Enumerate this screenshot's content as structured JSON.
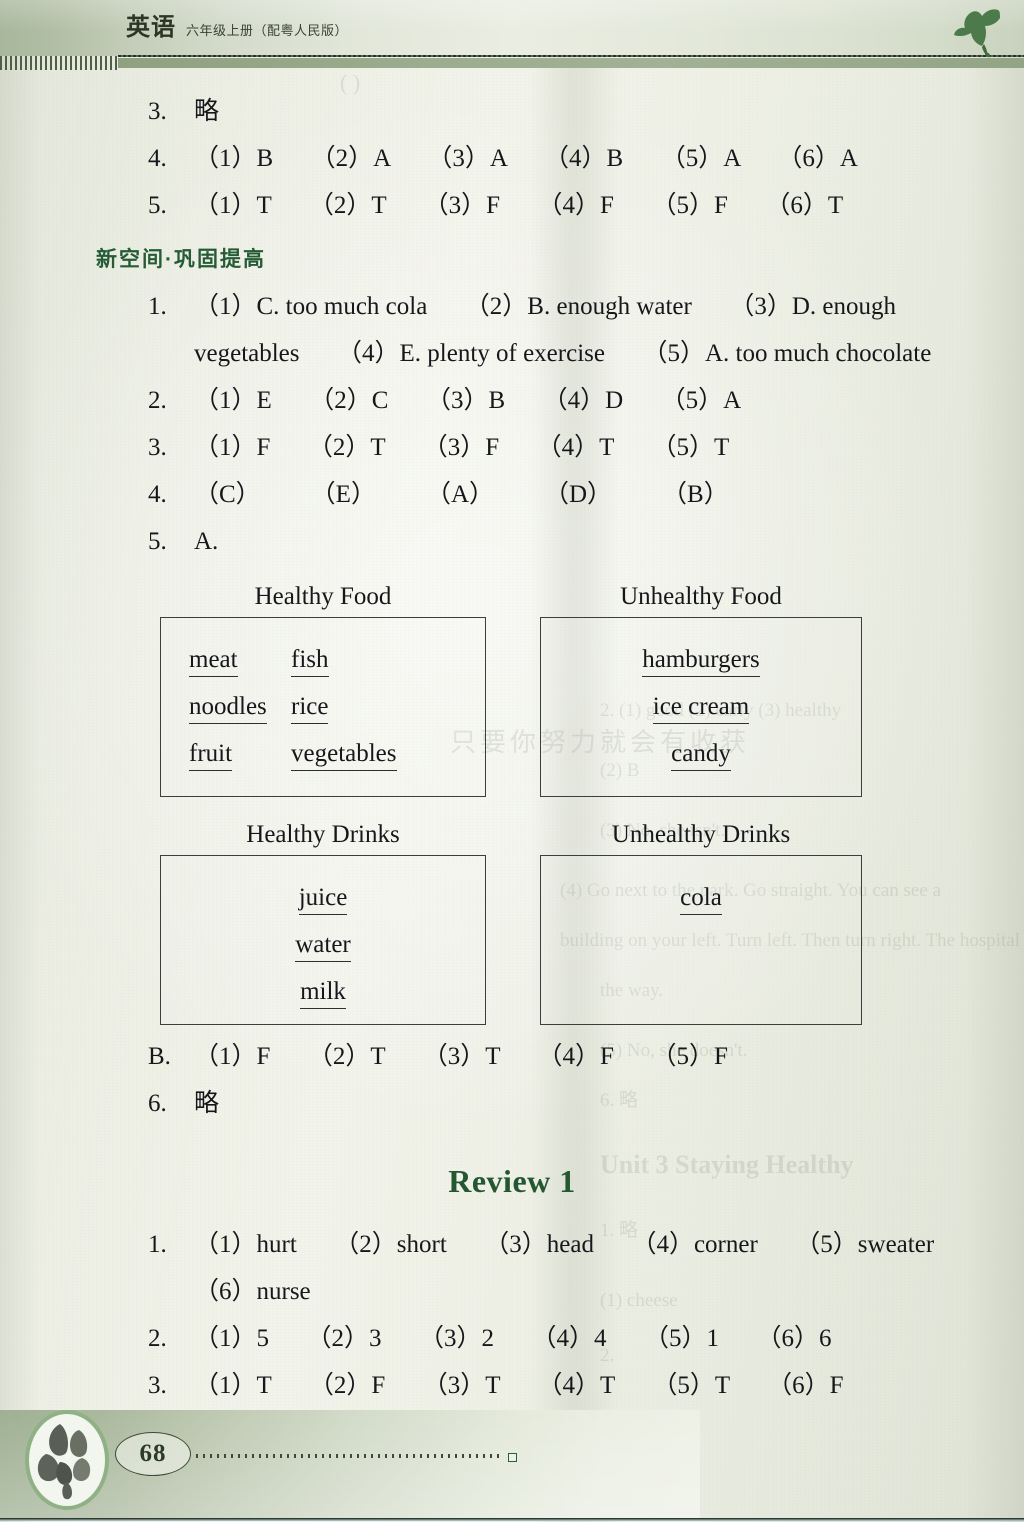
{
  "header": {
    "title": "英语",
    "subtitle": "六年级上册（配粤人民版）",
    "ornament_icon": "leaf-ornament-icon"
  },
  "content": {
    "pre_lines": [
      {
        "num": "3.",
        "answers": "略"
      },
      {
        "num": "4.",
        "answers": "（1）B　　（2）A　　（3）A　　（4）B　　（5）A　　（6）A"
      },
      {
        "num": "5.",
        "answers": "（1）T　　（2）T　　（3）F　　（4）F　　（5）F　　（6）T"
      }
    ],
    "section_heading": "新空间·巩固提高",
    "exercise_1": {
      "num": "1.",
      "line1": "（1）C.  too  much  cola　　（2）B.  enough  water　　（3）D.  enough",
      "line2": "vegetables　　（4）E.  plenty of exercise　　（5）A.  too much chocolate"
    },
    "exercise_2": {
      "num": "2.",
      "answers": "（1）E　　（2）C　　（3）B　　（4）D　　（5）A"
    },
    "exercise_3": {
      "num": "3.",
      "answers": "（1）F　　（2）T　　（3）F　　（4）T　　（5）T"
    },
    "exercise_4": {
      "num": "4.",
      "answers": "（C）　　　（E）　　　（A）　　　（D）　　　（B）"
    },
    "exercise_5": {
      "num": "5.",
      "label": "A."
    },
    "sort_tables": {
      "food": {
        "left_caption": "Healthy Food",
        "right_caption": "Unhealthy Food",
        "left_rows": [
          {
            "a": "meat",
            "b": "fish"
          },
          {
            "a": "noodles",
            "b": "rice"
          },
          {
            "a": "fruit",
            "b": "vegetables"
          }
        ],
        "right_rows": [
          "hamburgers",
          "ice cream",
          "candy"
        ]
      },
      "drinks": {
        "left_caption": "Healthy Drinks",
        "right_caption": "Unhealthy Drinks",
        "left_rows": [
          "juice",
          "water",
          "milk"
        ],
        "right_rows": [
          "cola"
        ]
      }
    },
    "exercise_5b": {
      "label": "B.",
      "answers": "（1）F　　（2）T　　（3）T　　（4）F　　（5）F"
    },
    "exercise_6": {
      "num": "6.",
      "answers": "略"
    }
  },
  "review": {
    "heading": "Review 1",
    "item_1": {
      "num": "1.",
      "line1": "（1）hurt　　（2）short　　（3）head　　（4）corner　　（5）sweater",
      "line2": "（6）nurse"
    },
    "item_2": {
      "num": "2.",
      "answers": "（1）5　　（2）3　　（3）2　　（4）4　　（5）1　　（6）6"
    },
    "item_3": {
      "num": "3.",
      "answers": "（1）T　　（2）F　　（3）T　　（4）T　　（5）T　　（6）F"
    }
  },
  "footer": {
    "page_number": "68",
    "flower_icon": "flower-logo-icon",
    "dot_end_icon": "square-marker-icon"
  },
  "colors": {
    "heading_green": "#255c36",
    "review_green": "#22572f",
    "band_green": "#9cac8e",
    "text_black": "#15171a"
  }
}
